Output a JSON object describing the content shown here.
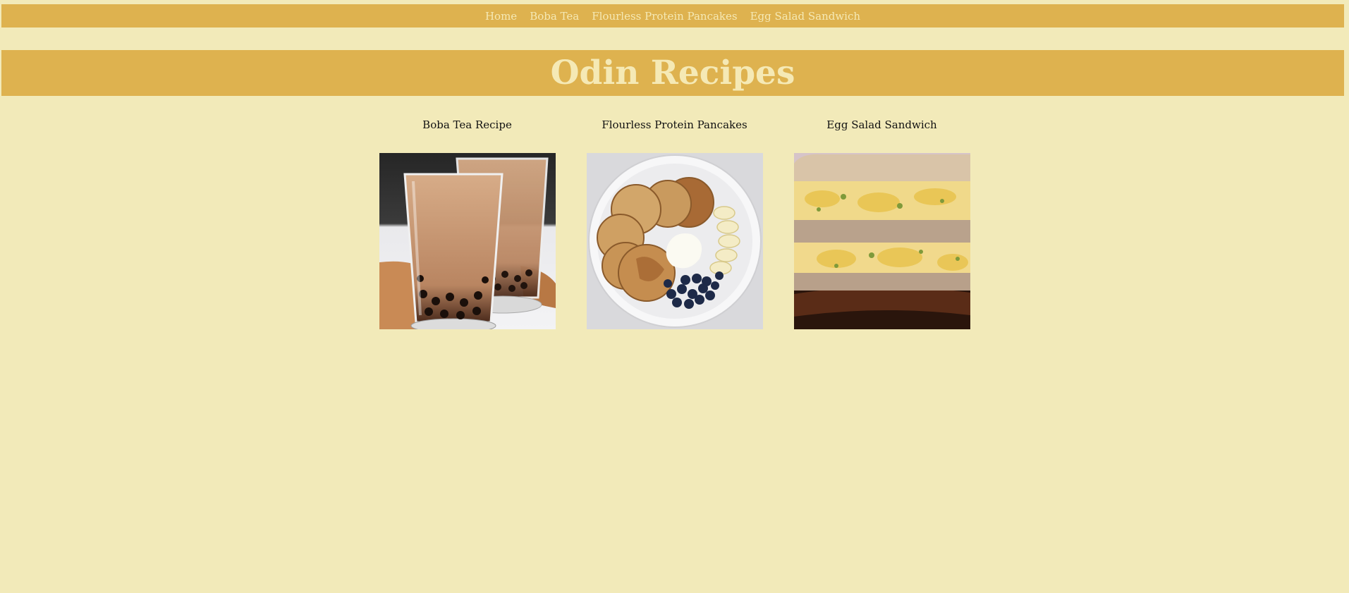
{
  "nav": {
    "items": [
      "Home",
      "Boba Tea",
      "Flourless Protein Pancakes",
      "Egg Salad Sandwich"
    ]
  },
  "header": {
    "title": "Odin Recipes"
  },
  "recipes": [
    {
      "title": "Boba Tea Recipe",
      "image": "boba-tea-photo"
    },
    {
      "title": "Flourless Protein Pancakes",
      "image": "protein-pancakes-photo"
    },
    {
      "title": "Egg Salad Sandwich",
      "image": "egg-salad-sandwich-photo"
    }
  ],
  "colors": {
    "background": "#f2eab9",
    "bar": "#deb24f",
    "bar_text": "#f5e9b5",
    "body_text": "#111111"
  }
}
